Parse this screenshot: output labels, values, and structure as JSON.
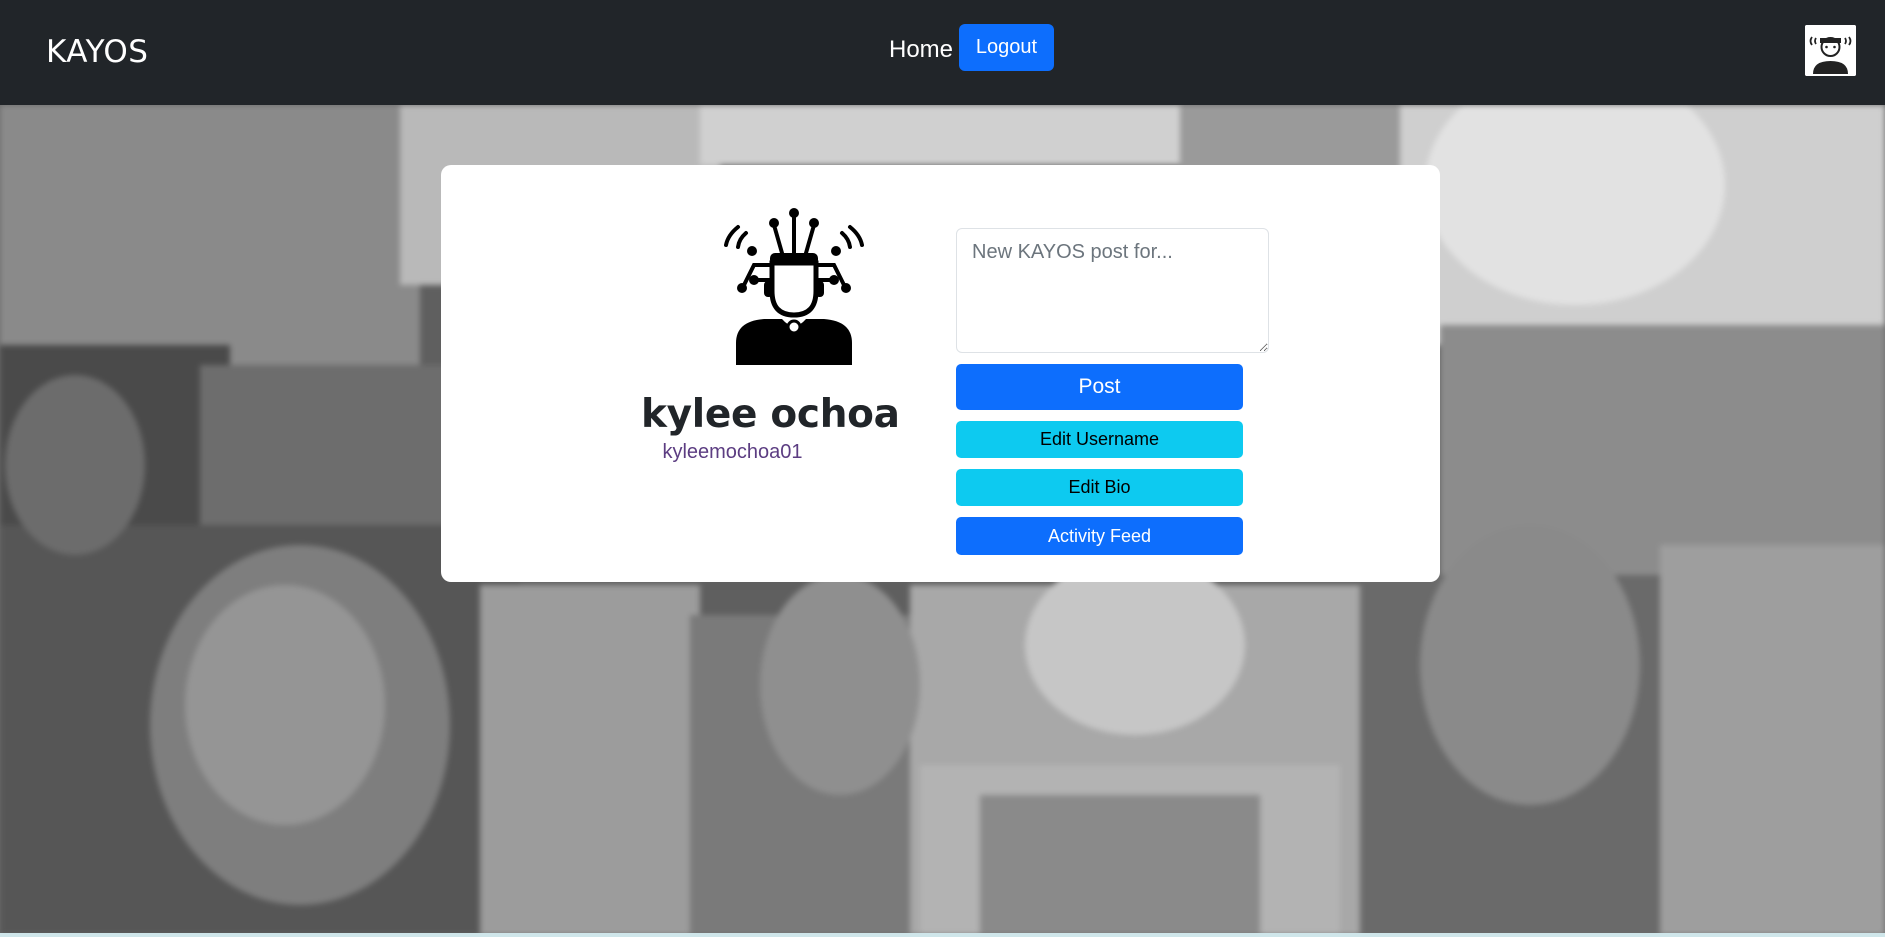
{
  "navbar": {
    "brand": "KAYOS",
    "home_label": "Home",
    "logout_label": "Logout",
    "avatar_icon": "user-avatar-icon",
    "background_color": "#212529"
  },
  "background": {
    "description_icon": "faces-collage-background"
  },
  "profile": {
    "icon": "profile-circuit-head-icon",
    "display_name": "kylee ochoa",
    "username": "kyleemochoa01"
  },
  "post": {
    "placeholder": "New KAYOS post for...",
    "value": "",
    "post_label": "Post"
  },
  "actions": {
    "edit_username_label": "Edit Username",
    "edit_bio_label": "Edit Bio",
    "activity_feed_label": "Activity Feed"
  },
  "colors": {
    "primary": "#0d6efd",
    "info": "#0dcaf0",
    "username": "#5c3d82"
  }
}
